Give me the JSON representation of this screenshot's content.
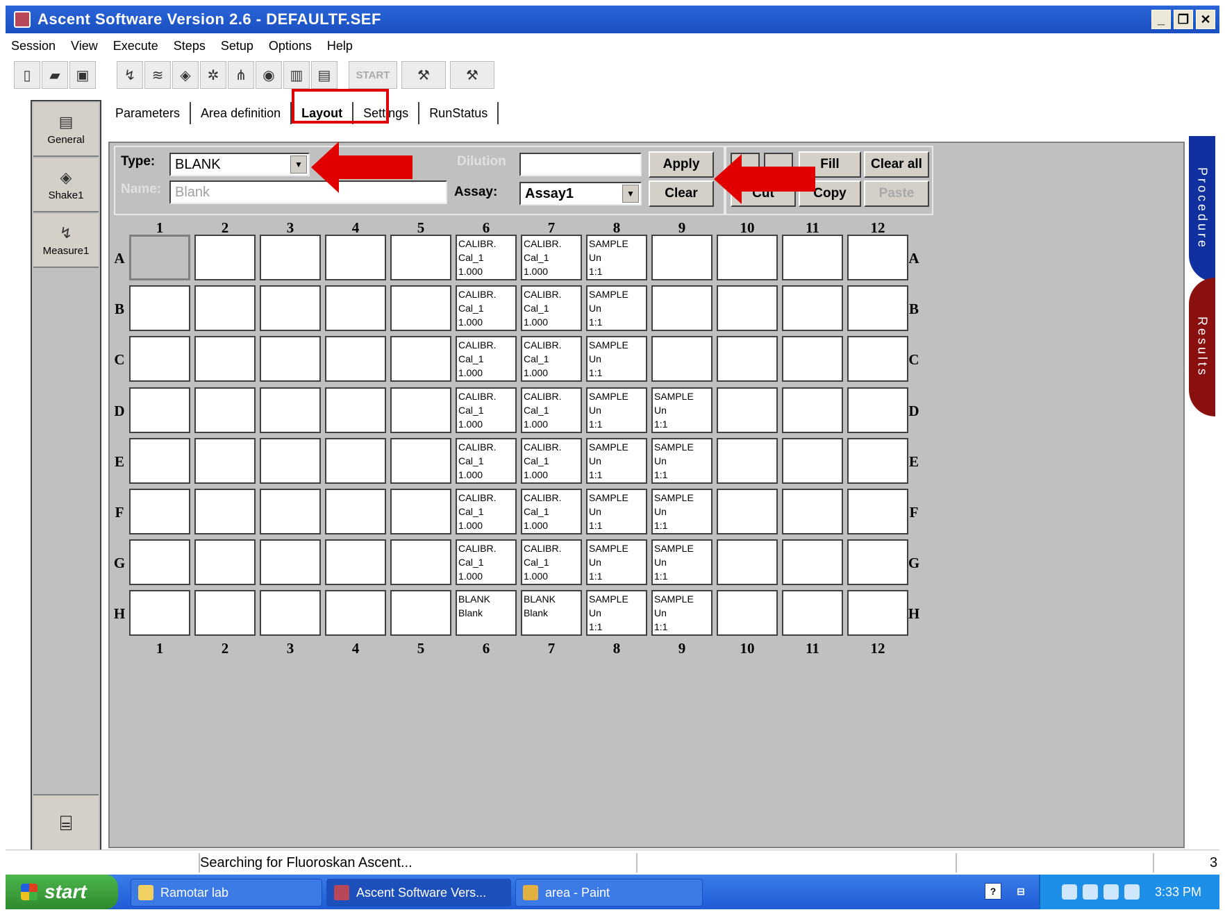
{
  "window": {
    "title": "Ascent Software Version 2.6 - DEFAULTF.SEF",
    "controls": [
      "_",
      "❐",
      "✕"
    ]
  },
  "menu": [
    "Session",
    "View",
    "Execute",
    "Steps",
    "Setup",
    "Options",
    "Help"
  ],
  "toolbar": {
    "start_label": "START"
  },
  "left_panel": {
    "items": [
      {
        "label": "General",
        "icon": "document-icon"
      },
      {
        "label": "Shake1",
        "icon": "shake-icon"
      },
      {
        "label": "Measure1",
        "icon": "measure-icon"
      }
    ],
    "bottom_icon": "trash-can-icon"
  },
  "tabs": [
    "Parameters",
    "Area definition",
    "Layout",
    "Settings",
    "RunStatus"
  ],
  "active_tab": "Layout",
  "form": {
    "type_label": "Type:",
    "type_value": "BLANK",
    "name_label": "Name:",
    "name_value": "Blank",
    "dilution_label": "Dilution",
    "dilution_value": "",
    "assay_label": "Assay:",
    "assay_value": "Assay1",
    "apply_label": "Apply",
    "clear_label": "Clear",
    "fill_label": "Fill",
    "clear_all_label": "Clear all",
    "cut_label": "Cut",
    "copy_label": "Copy",
    "paste_label": "Paste"
  },
  "plate": {
    "columns": [
      "1",
      "2",
      "3",
      "4",
      "5",
      "6",
      "7",
      "8",
      "9",
      "10",
      "11",
      "12"
    ],
    "rows": [
      "A",
      "B",
      "C",
      "D",
      "E",
      "F",
      "G",
      "H"
    ],
    "wells": {
      "A": [
        "",
        "",
        "",
        "",
        "",
        "CALIBR.\nCal_1\n1.000",
        "CALIBR.\nCal_1\n1.000",
        "SAMPLE\nUn\n1:1",
        "",
        "",
        "",
        ""
      ],
      "B": [
        "",
        "",
        "",
        "",
        "",
        "CALIBR.\nCal_1\n1.000",
        "CALIBR.\nCal_1\n1.000",
        "SAMPLE\nUn\n1:1",
        "",
        "",
        "",
        ""
      ],
      "C": [
        "",
        "",
        "",
        "",
        "",
        "CALIBR.\nCal_1\n1.000",
        "CALIBR.\nCal_1\n1.000",
        "SAMPLE\nUn\n1:1",
        "",
        "",
        "",
        ""
      ],
      "D": [
        "",
        "",
        "",
        "",
        "",
        "CALIBR.\nCal_1\n1.000",
        "CALIBR.\nCal_1\n1.000",
        "SAMPLE\nUn\n1:1",
        "SAMPLE\nUn\n1:1",
        "",
        "",
        ""
      ],
      "E": [
        "",
        "",
        "",
        "",
        "",
        "CALIBR.\nCal_1\n1.000",
        "CALIBR.\nCal_1\n1.000",
        "SAMPLE\nUn\n1:1",
        "SAMPLE\nUn\n1:1",
        "",
        "",
        ""
      ],
      "F": [
        "",
        "",
        "",
        "",
        "",
        "CALIBR.\nCal_1\n1.000",
        "CALIBR.\nCal_1\n1.000",
        "SAMPLE\nUn\n1:1",
        "SAMPLE\nUn\n1:1",
        "",
        "",
        ""
      ],
      "G": [
        "",
        "",
        "",
        "",
        "",
        "CALIBR.\nCal_1\n1.000",
        "CALIBR.\nCal_1\n1.000",
        "SAMPLE\nUn\n1:1",
        "SAMPLE\nUn\n1:1",
        "",
        "",
        ""
      ],
      "H": [
        "",
        "",
        "",
        "",
        "",
        "BLANK\nBlank",
        "BLANK\nBlank",
        "SAMPLE\nUn\n1:1",
        "SAMPLE\nUn\n1:1",
        "",
        "",
        ""
      ]
    },
    "selected_well": "A1"
  },
  "side_tabs": [
    "Procedure",
    "Results"
  ],
  "status": {
    "message": "Searching for Fluoroskan Ascent...",
    "page": "3"
  },
  "taskbar": {
    "start_label": "start",
    "items": [
      "Ramotar lab",
      "Ascent Software Vers...",
      "area - Paint"
    ],
    "clock": "3:33 PM"
  },
  "colors": {
    "titlebar": "#1a4fc0",
    "workspace": "#c0c0c0",
    "highlight": "#e00000",
    "procedure_tab": "#1030a0",
    "results_tab": "#8a1010",
    "taskbar": "#1f5bd6"
  }
}
